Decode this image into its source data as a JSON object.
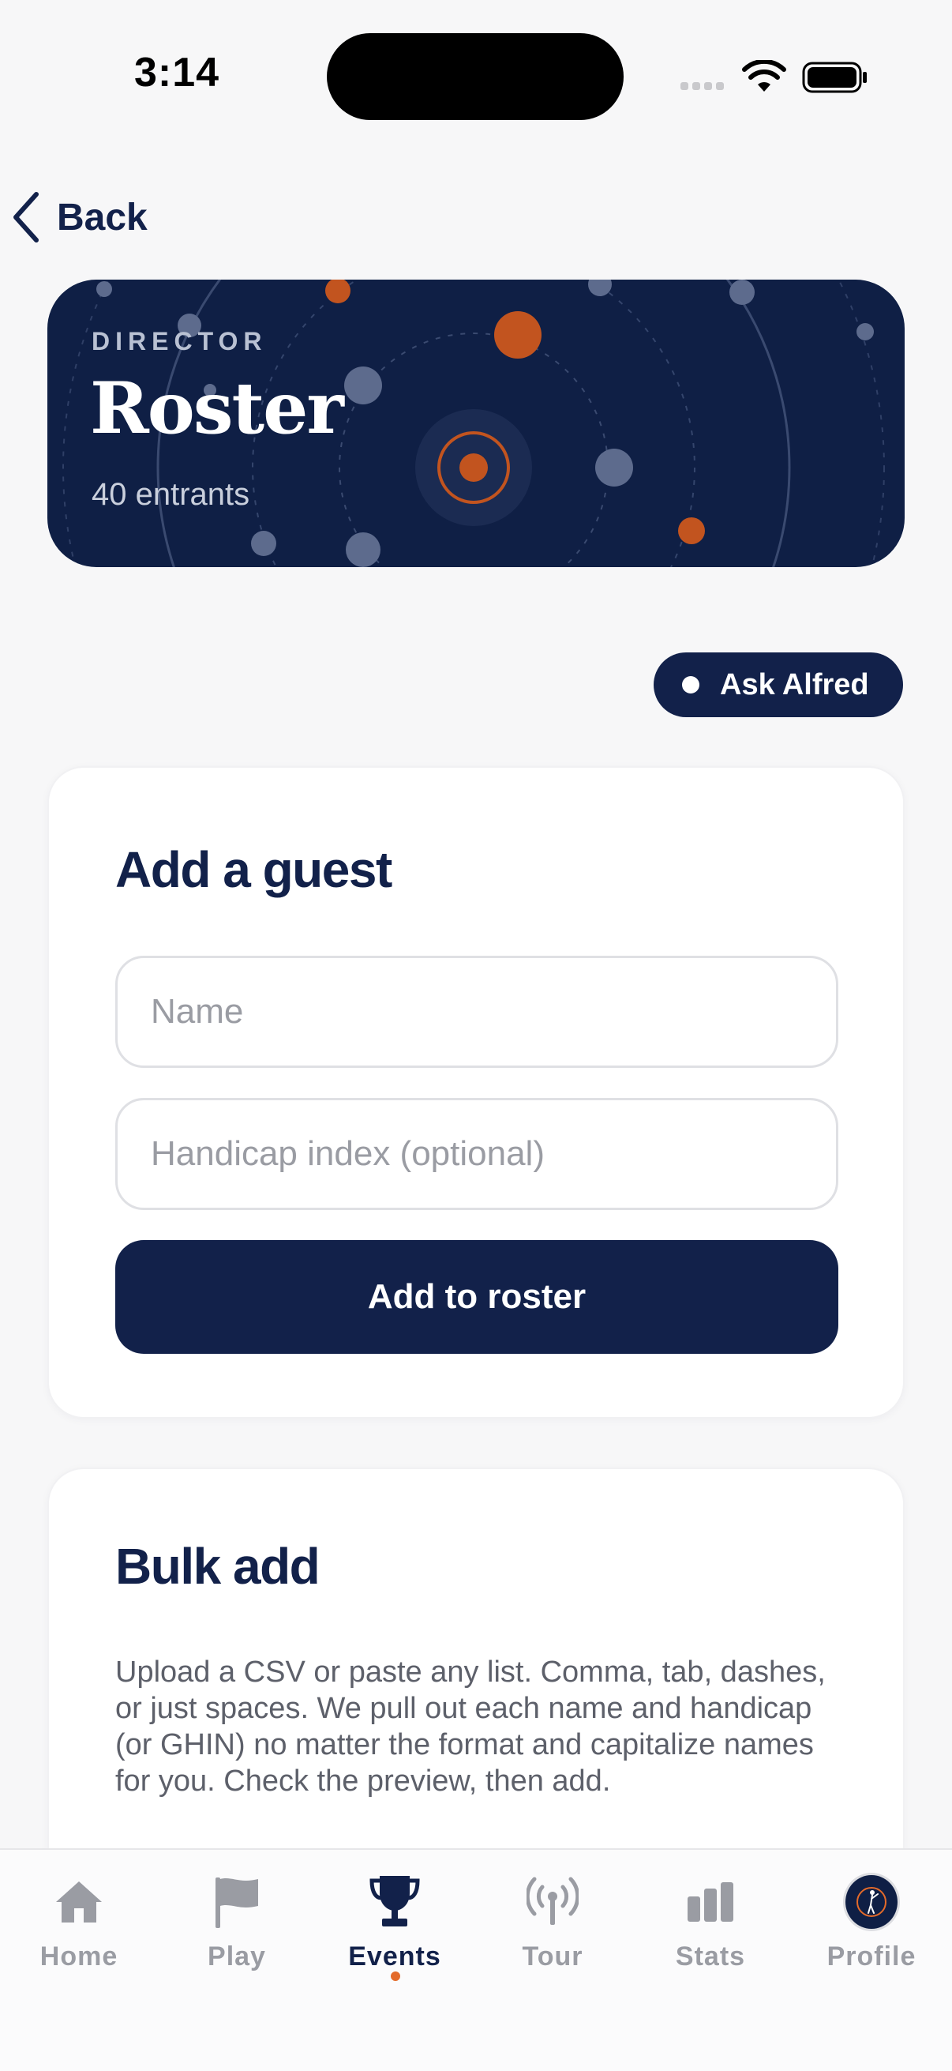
{
  "status": {
    "time": "3:14"
  },
  "nav": {
    "back_label": "Back"
  },
  "hero": {
    "eyebrow": "DIRECTOR",
    "title": "Roster",
    "subtitle": "40 entrants"
  },
  "ask": {
    "label": "Ask Alfred"
  },
  "guest_card": {
    "title": "Add a guest",
    "name_placeholder": "Name",
    "handicap_placeholder": "Handicap index (optional)",
    "submit_label": "Add to roster"
  },
  "bulk_card": {
    "title": "Bulk add",
    "description": "Upload a CSV or paste any list. Comma, tab, dashes, or just spaces. We pull out each name and handicap (or GHIN) no matter the format and capitalize names for you. Check the preview, then add."
  },
  "tabbar": {
    "items": [
      {
        "label": "Home",
        "icon": "home-icon",
        "active": false
      },
      {
        "label": "Play",
        "icon": "flag-icon",
        "active": false
      },
      {
        "label": "Events",
        "icon": "trophy-icon",
        "active": true
      },
      {
        "label": "Tour",
        "icon": "broadcast-icon",
        "active": false
      },
      {
        "label": "Stats",
        "icon": "bar-chart-icon",
        "active": false
      },
      {
        "label": "Profile",
        "icon": "avatar",
        "active": false
      }
    ]
  },
  "colors": {
    "navy": "#12214a",
    "accent": "#e36a2a",
    "inactive": "#9a9ca3"
  }
}
